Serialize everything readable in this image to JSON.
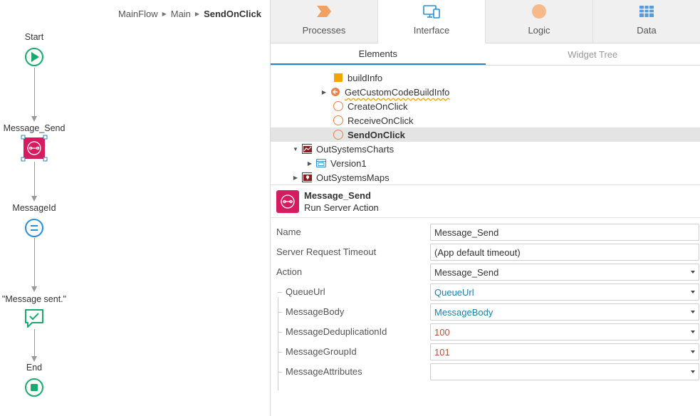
{
  "breadcrumb": {
    "items": [
      "MainFlow",
      "Main"
    ],
    "current": "SendOnClick"
  },
  "flow": {
    "nodes": [
      {
        "label": "Start",
        "icon": "start-icon"
      },
      {
        "label": "Message_Send",
        "icon": "server-action-icon"
      },
      {
        "label": "MessageId",
        "icon": "assign-icon"
      },
      {
        "label": "\"Message sent.\"",
        "icon": "message-icon"
      },
      {
        "label": "End",
        "icon": "end-icon"
      }
    ]
  },
  "top_tabs": [
    {
      "label": "Processes",
      "icon": "processes-icon"
    },
    {
      "label": "Interface",
      "icon": "interface-icon",
      "active": true
    },
    {
      "label": "Logic",
      "icon": "logic-icon"
    },
    {
      "label": "Data",
      "icon": "data-icon"
    }
  ],
  "sub_tabs": [
    {
      "label": "Elements",
      "active": true
    },
    {
      "label": "Widget Tree"
    }
  ],
  "tree": {
    "items": [
      {
        "label": "buildInfo",
        "icon": "variable-icon"
      },
      {
        "label": "GetCustomCodeBuildInfo",
        "icon": "data-action-icon"
      },
      {
        "label": "CreateOnClick",
        "icon": "client-action-icon"
      },
      {
        "label": "ReceiveOnClick",
        "icon": "client-action-icon"
      },
      {
        "label": "SendOnClick",
        "icon": "client-action-icon",
        "selected": true
      },
      {
        "label": "OutSystemsCharts",
        "icon": "module-charts-icon"
      },
      {
        "label": "Version1",
        "icon": "block-icon"
      },
      {
        "label": "OutSystemsMaps",
        "icon": "module-maps-icon"
      }
    ]
  },
  "action": {
    "name": "Message_Send",
    "type": "Run Server Action",
    "icon": "server-action-icon"
  },
  "properties": [
    {
      "label": "Name",
      "value": "Message_Send",
      "dropdown": false
    },
    {
      "label": "Server Request Timeout",
      "value": "(App default timeout)",
      "dropdown": false
    },
    {
      "label": "Action",
      "value": "Message_Send",
      "dropdown": true
    },
    {
      "label": "QueueUrl",
      "value": "QueueUrl",
      "dropdown": true,
      "style": "blue"
    },
    {
      "label": "MessageBody",
      "value": "MessageBody",
      "dropdown": true,
      "style": "blue"
    },
    {
      "label": "MessageDeduplicationId",
      "value": "100",
      "dropdown": true,
      "style": "number"
    },
    {
      "label": "MessageGroupId",
      "value": "101",
      "dropdown": true,
      "style": "number"
    },
    {
      "label": "MessageAttributes",
      "value": "",
      "dropdown": true
    }
  ],
  "colors": {
    "accent": "#2f7fc1",
    "flow_green": "#1aaa6b",
    "assign_blue": "#2a8fd4",
    "server_action": "#d81b60",
    "client_action": "#e8824a",
    "variable": "#f0a500"
  }
}
